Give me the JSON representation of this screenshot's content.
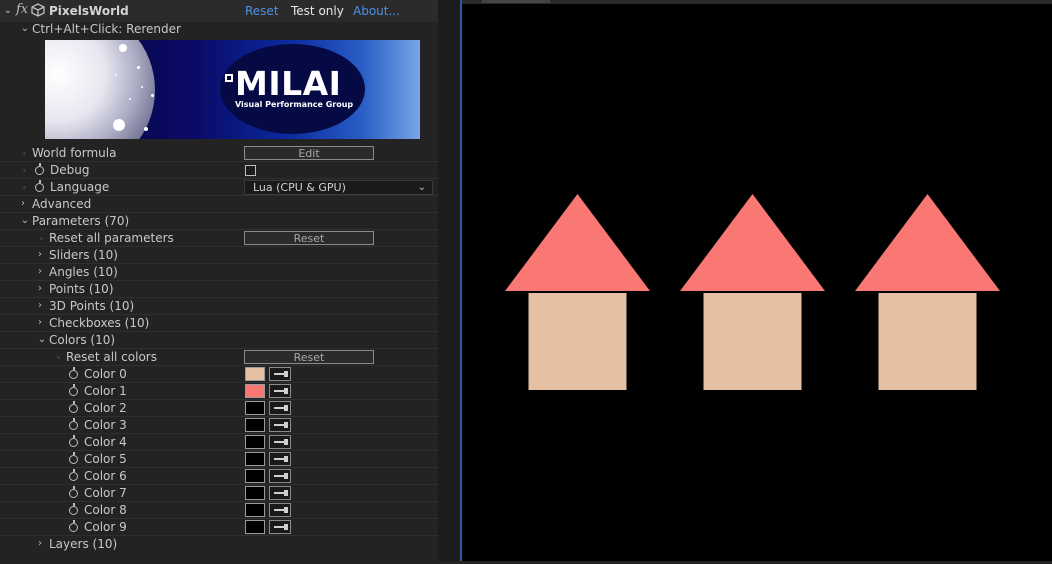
{
  "effect": {
    "fx_glyph": "fx",
    "name": "PixelsWorld",
    "links": {
      "reset": "Reset",
      "test_only": "Test only",
      "about": "About..."
    }
  },
  "rerender_label": "Ctrl+Alt+Click: Rerender",
  "banner": {
    "logo": "MILAI",
    "tagline": "Visual Performance Group"
  },
  "world_formula": {
    "label": "World formula",
    "button": "Edit"
  },
  "debug": {
    "label": "Debug",
    "checked": false
  },
  "language": {
    "label": "Language",
    "value": "Lua (CPU & GPU)"
  },
  "advanced": {
    "label": "Advanced"
  },
  "parameters": {
    "label": "Parameters (70)",
    "reset_all_label": "Reset all parameters",
    "reset_button": "Reset",
    "groups": {
      "sliders": "Sliders (10)",
      "angles": "Angles (10)",
      "points": "Points (10)",
      "points3d": "3D Points (10)",
      "checkboxes": "Checkboxes (10)",
      "colors": "Colors (10)",
      "layers": "Layers (10)"
    },
    "colors": {
      "reset_all_label": "Reset all colors",
      "reset_button": "Reset",
      "items": [
        {
          "label": "Color 0",
          "value": "#e6c0a3"
        },
        {
          "label": "Color 1",
          "value": "#fa7873"
        },
        {
          "label": "Color 2",
          "value": "#000000"
        },
        {
          "label": "Color 3",
          "value": "#000000"
        },
        {
          "label": "Color 4",
          "value": "#000000"
        },
        {
          "label": "Color 5",
          "value": "#000000"
        },
        {
          "label": "Color 6",
          "value": "#000000"
        },
        {
          "label": "Color 7",
          "value": "#000000"
        },
        {
          "label": "Color 8",
          "value": "#000000"
        },
        {
          "label": "Color 9",
          "value": "#000000"
        }
      ]
    }
  },
  "viewer": {
    "background": "#000000",
    "houses": [
      {
        "roof_color": "#fa7873",
        "wall_color": "#e6c0a3"
      },
      {
        "roof_color": "#fa7873",
        "wall_color": "#e6c0a3"
      },
      {
        "roof_color": "#fa7873",
        "wall_color": "#e6c0a3"
      }
    ]
  },
  "ui_colors": {
    "link": "#4f8fe6",
    "panel_bg": "#232323",
    "viewer_divider": "#2d5aa8"
  }
}
